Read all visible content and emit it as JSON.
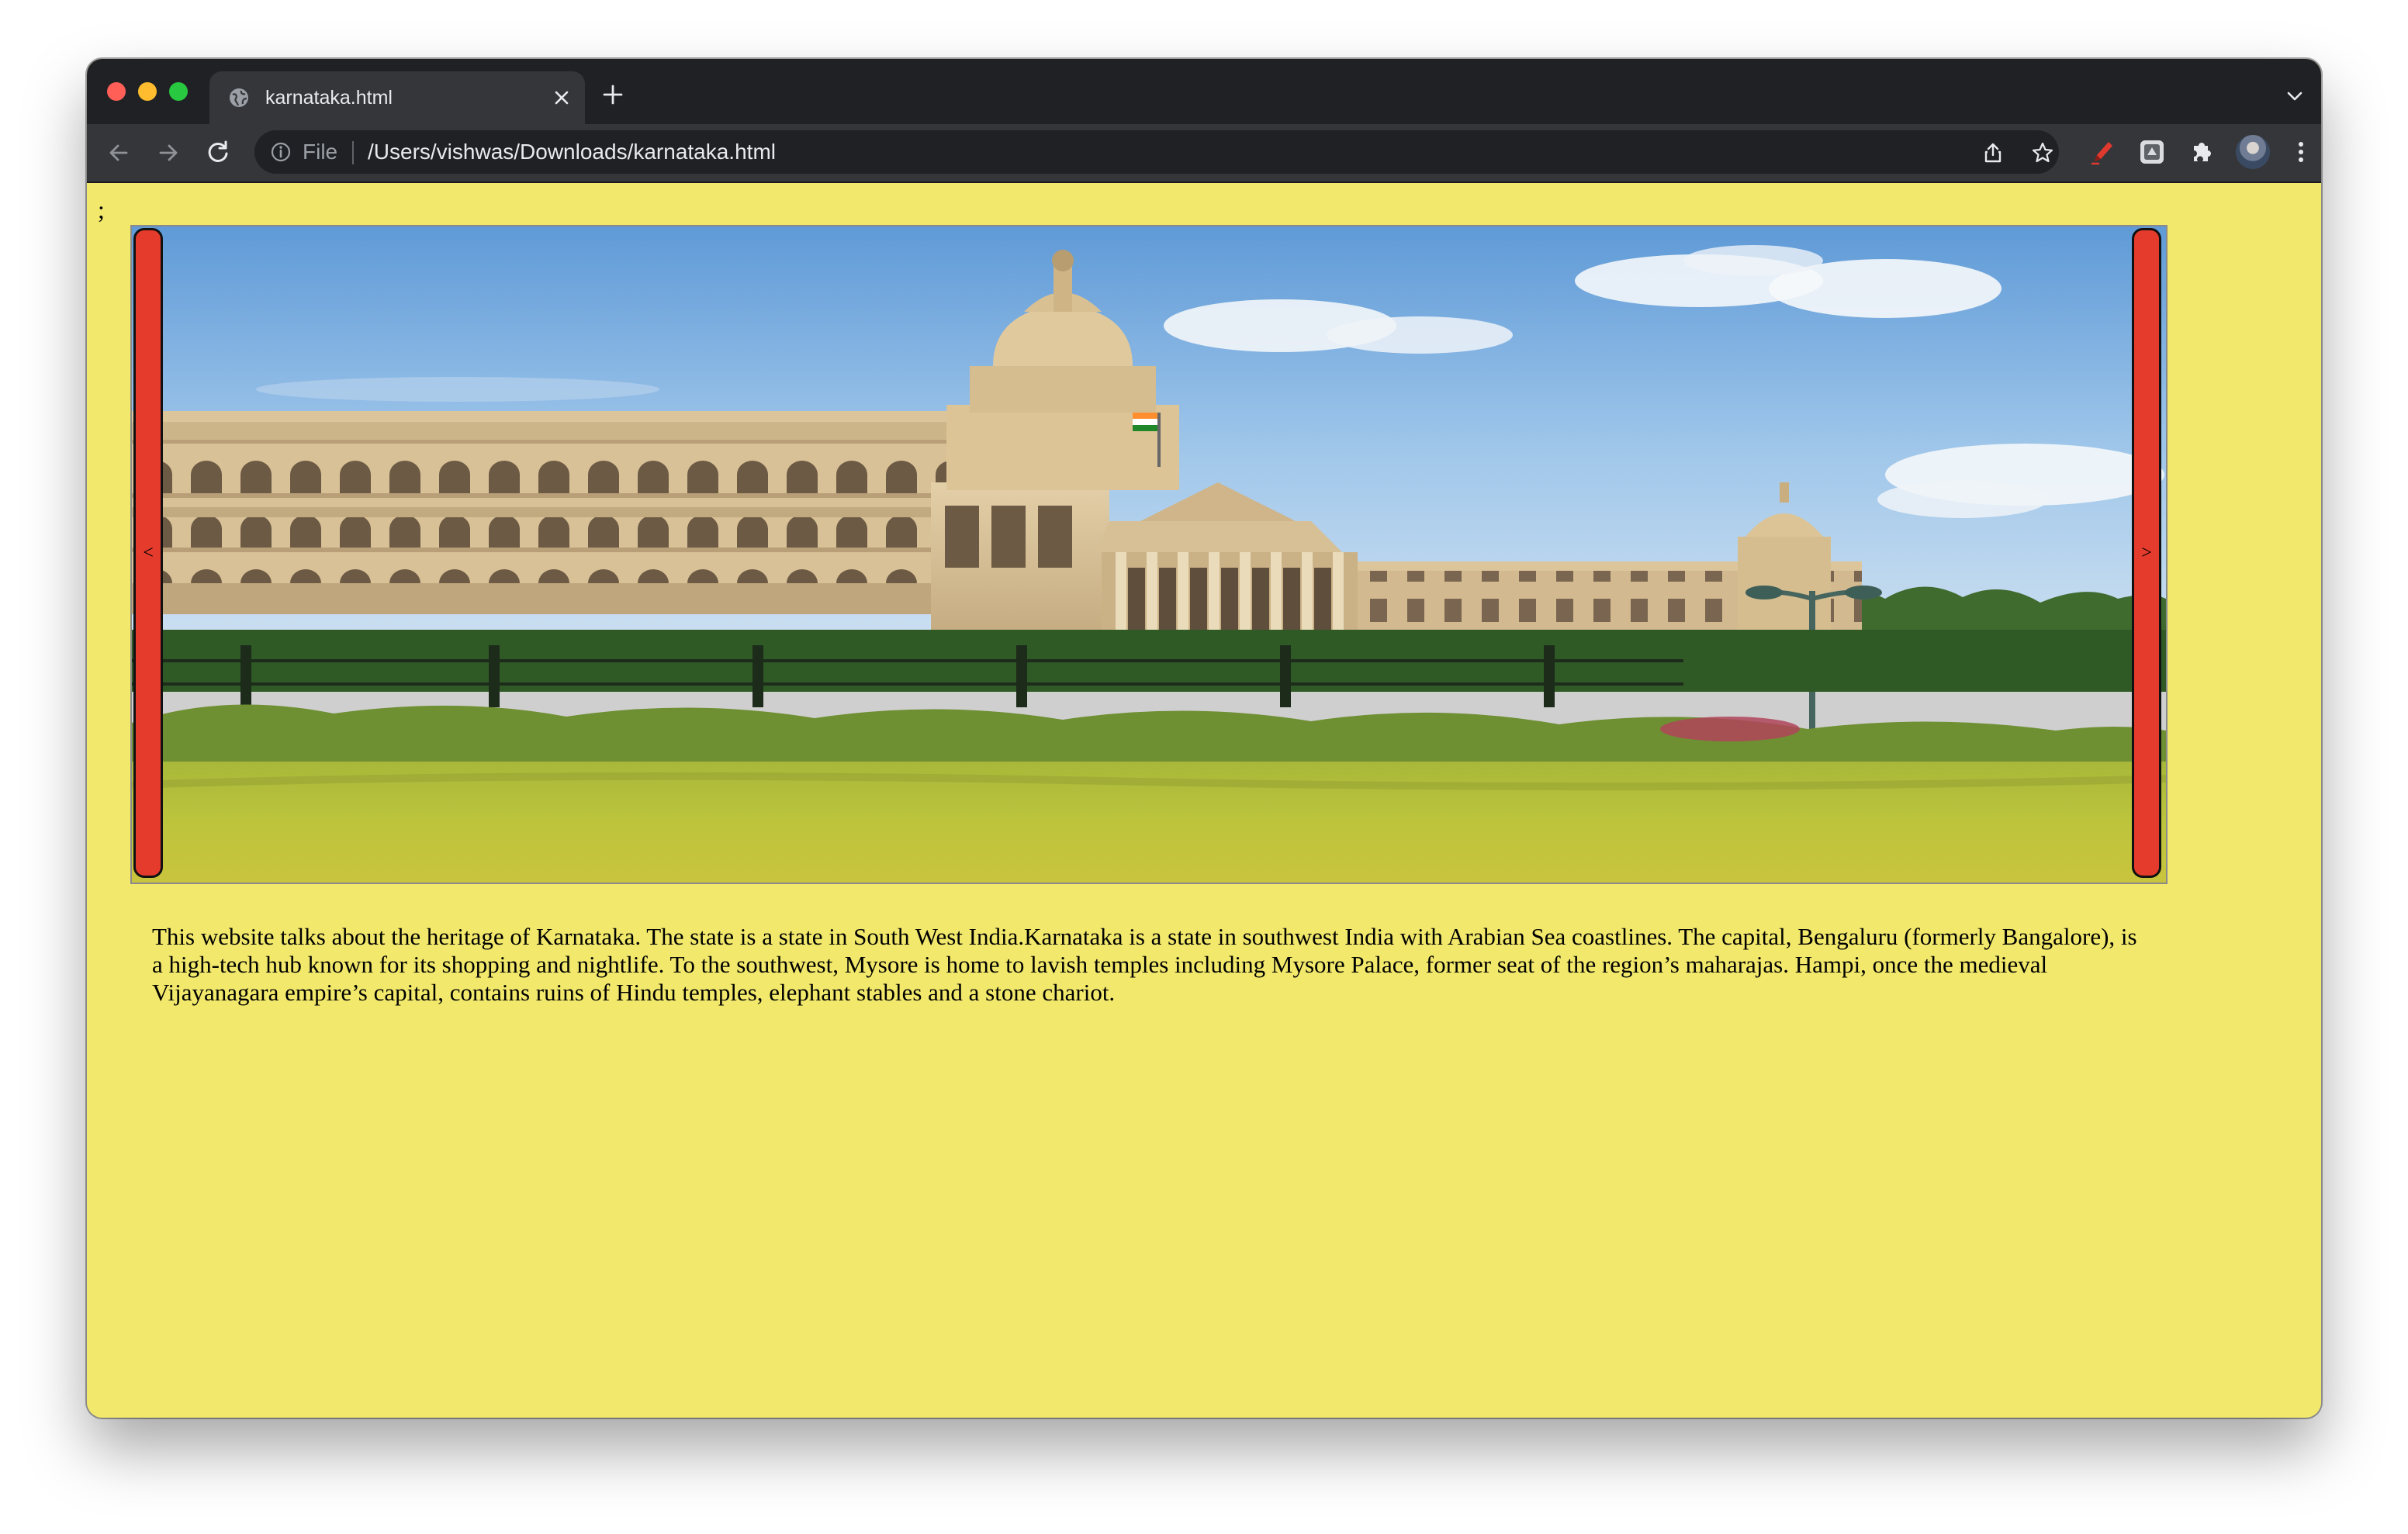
{
  "browser": {
    "tab": {
      "title": "karnataka.html"
    },
    "address_bar": {
      "scheme_label": "File",
      "url": "/Users/vishwas/Downloads/karnataka.html"
    },
    "icons": {
      "favicon": "globe-icon",
      "tab_close": "close-icon",
      "new_tab": "plus-icon",
      "tab_search": "chevron-down-icon",
      "back": "arrow-left-icon",
      "forward": "arrow-right-icon",
      "reload": "reload-icon",
      "site_info": "info-icon",
      "share": "share-icon",
      "bookmark": "star-icon",
      "extension_pen": "pen-icon",
      "extension_app": "extension-app-icon",
      "extensions": "puzzle-icon",
      "profile": "avatar",
      "menu": "kebab-menu-icon"
    }
  },
  "page": {
    "stray_text": ";",
    "slider": {
      "prev_label": "<",
      "next_label": ">",
      "image_subject": "Vidhana Soudha building with lawn and blue sky"
    },
    "description": "This website talks about the heritage of Karnataka. The state is a state in South West India.Karnataka is a state in southwest India with Arabian Sea coastlines. The capital, Bengaluru (formerly Bangalore), is a high-tech hub known for its shopping and nightlife. To the southwest, Mysore is home to lavish temples including Mysore Palace, former seat of the region’s maharajas. Hampi, once the medieval Vijayanagara empire’s capital, contains ruins of Hindu temples, elephant stables and a stone chariot."
  },
  "colors": {
    "page_background": "#f2e96c",
    "slider_button": "#e53b2c",
    "browser_frame": "#202124",
    "toolbar": "#35363a"
  }
}
